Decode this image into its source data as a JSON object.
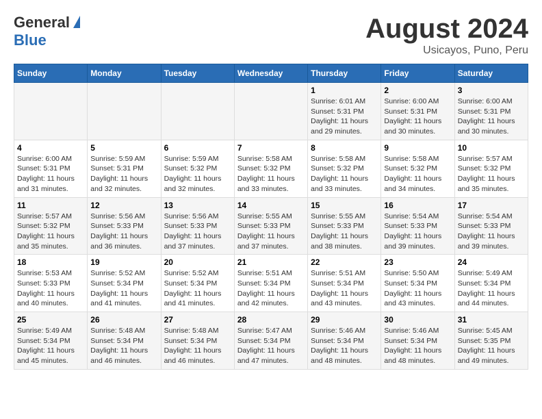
{
  "header": {
    "logo_general": "General",
    "logo_blue": "Blue",
    "month_title": "August 2024",
    "subtitle": "Usicayos, Puno, Peru"
  },
  "calendar": {
    "days_of_week": [
      "Sunday",
      "Monday",
      "Tuesday",
      "Wednesday",
      "Thursday",
      "Friday",
      "Saturday"
    ],
    "weeks": [
      [
        {
          "day": "",
          "info": ""
        },
        {
          "day": "",
          "info": ""
        },
        {
          "day": "",
          "info": ""
        },
        {
          "day": "",
          "info": ""
        },
        {
          "day": "1",
          "info": "Sunrise: 6:01 AM\nSunset: 5:31 PM\nDaylight: 11 hours and 29 minutes."
        },
        {
          "day": "2",
          "info": "Sunrise: 6:00 AM\nSunset: 5:31 PM\nDaylight: 11 hours and 30 minutes."
        },
        {
          "day": "3",
          "info": "Sunrise: 6:00 AM\nSunset: 5:31 PM\nDaylight: 11 hours and 30 minutes."
        }
      ],
      [
        {
          "day": "4",
          "info": "Sunrise: 6:00 AM\nSunset: 5:31 PM\nDaylight: 11 hours and 31 minutes."
        },
        {
          "day": "5",
          "info": "Sunrise: 5:59 AM\nSunset: 5:31 PM\nDaylight: 11 hours and 32 minutes."
        },
        {
          "day": "6",
          "info": "Sunrise: 5:59 AM\nSunset: 5:32 PM\nDaylight: 11 hours and 32 minutes."
        },
        {
          "day": "7",
          "info": "Sunrise: 5:58 AM\nSunset: 5:32 PM\nDaylight: 11 hours and 33 minutes."
        },
        {
          "day": "8",
          "info": "Sunrise: 5:58 AM\nSunset: 5:32 PM\nDaylight: 11 hours and 33 minutes."
        },
        {
          "day": "9",
          "info": "Sunrise: 5:58 AM\nSunset: 5:32 PM\nDaylight: 11 hours and 34 minutes."
        },
        {
          "day": "10",
          "info": "Sunrise: 5:57 AM\nSunset: 5:32 PM\nDaylight: 11 hours and 35 minutes."
        }
      ],
      [
        {
          "day": "11",
          "info": "Sunrise: 5:57 AM\nSunset: 5:32 PM\nDaylight: 11 hours and 35 minutes."
        },
        {
          "day": "12",
          "info": "Sunrise: 5:56 AM\nSunset: 5:33 PM\nDaylight: 11 hours and 36 minutes."
        },
        {
          "day": "13",
          "info": "Sunrise: 5:56 AM\nSunset: 5:33 PM\nDaylight: 11 hours and 37 minutes."
        },
        {
          "day": "14",
          "info": "Sunrise: 5:55 AM\nSunset: 5:33 PM\nDaylight: 11 hours and 37 minutes."
        },
        {
          "day": "15",
          "info": "Sunrise: 5:55 AM\nSunset: 5:33 PM\nDaylight: 11 hours and 38 minutes."
        },
        {
          "day": "16",
          "info": "Sunrise: 5:54 AM\nSunset: 5:33 PM\nDaylight: 11 hours and 39 minutes."
        },
        {
          "day": "17",
          "info": "Sunrise: 5:54 AM\nSunset: 5:33 PM\nDaylight: 11 hours and 39 minutes."
        }
      ],
      [
        {
          "day": "18",
          "info": "Sunrise: 5:53 AM\nSunset: 5:33 PM\nDaylight: 11 hours and 40 minutes."
        },
        {
          "day": "19",
          "info": "Sunrise: 5:52 AM\nSunset: 5:34 PM\nDaylight: 11 hours and 41 minutes."
        },
        {
          "day": "20",
          "info": "Sunrise: 5:52 AM\nSunset: 5:34 PM\nDaylight: 11 hours and 41 minutes."
        },
        {
          "day": "21",
          "info": "Sunrise: 5:51 AM\nSunset: 5:34 PM\nDaylight: 11 hours and 42 minutes."
        },
        {
          "day": "22",
          "info": "Sunrise: 5:51 AM\nSunset: 5:34 PM\nDaylight: 11 hours and 43 minutes."
        },
        {
          "day": "23",
          "info": "Sunrise: 5:50 AM\nSunset: 5:34 PM\nDaylight: 11 hours and 43 minutes."
        },
        {
          "day": "24",
          "info": "Sunrise: 5:49 AM\nSunset: 5:34 PM\nDaylight: 11 hours and 44 minutes."
        }
      ],
      [
        {
          "day": "25",
          "info": "Sunrise: 5:49 AM\nSunset: 5:34 PM\nDaylight: 11 hours and 45 minutes."
        },
        {
          "day": "26",
          "info": "Sunrise: 5:48 AM\nSunset: 5:34 PM\nDaylight: 11 hours and 46 minutes."
        },
        {
          "day": "27",
          "info": "Sunrise: 5:48 AM\nSunset: 5:34 PM\nDaylight: 11 hours and 46 minutes."
        },
        {
          "day": "28",
          "info": "Sunrise: 5:47 AM\nSunset: 5:34 PM\nDaylight: 11 hours and 47 minutes."
        },
        {
          "day": "29",
          "info": "Sunrise: 5:46 AM\nSunset: 5:34 PM\nDaylight: 11 hours and 48 minutes."
        },
        {
          "day": "30",
          "info": "Sunrise: 5:46 AM\nSunset: 5:34 PM\nDaylight: 11 hours and 48 minutes."
        },
        {
          "day": "31",
          "info": "Sunrise: 5:45 AM\nSunset: 5:35 PM\nDaylight: 11 hours and 49 minutes."
        }
      ]
    ]
  }
}
